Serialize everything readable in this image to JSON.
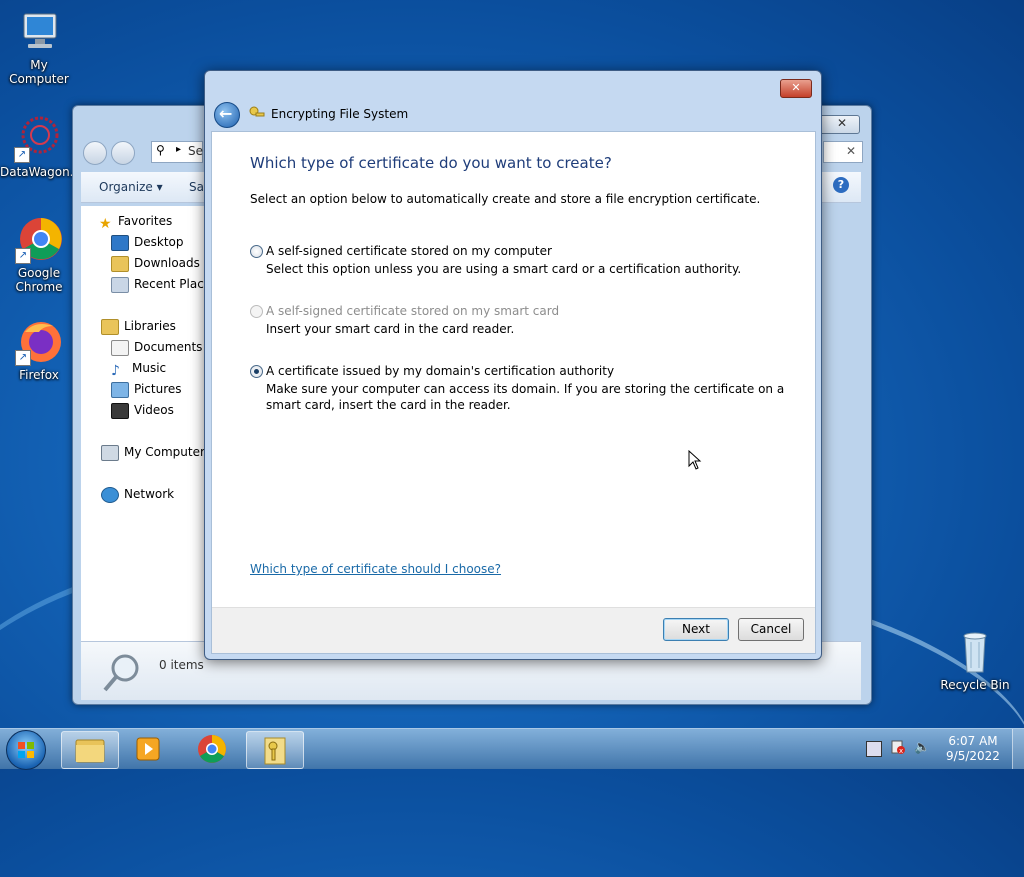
{
  "desktop": {
    "icons": [
      {
        "label": "My Computer"
      },
      {
        "label": "DataWagon..."
      },
      {
        "label": "Google Chrome"
      },
      {
        "label": "Firefox"
      },
      {
        "label": "Recycle Bin"
      }
    ]
  },
  "explorer": {
    "search_fragment": "Se",
    "organize_label": "Organize ▾",
    "save_fragment": "Sav",
    "nav": {
      "favorites": "Favorites",
      "desktop": "Desktop",
      "downloads": "Downloads",
      "recent_places": "Recent Places",
      "libraries": "Libraries",
      "documents": "Documents",
      "music": "Music",
      "pictures": "Pictures",
      "videos": "Videos",
      "my_computer": "My Computer",
      "network": "Network"
    },
    "item_count": "0 items"
  },
  "dialog": {
    "title": "Encrypting File System",
    "heading": "Which type of certificate do you want to create?",
    "intro": "Select an option below to automatically create and store a file encryption certificate.",
    "options": [
      {
        "label": "A self-signed certificate stored on my computer",
        "description": "Select this option unless you are using a smart card or a certification authority.",
        "selected": false,
        "enabled": true
      },
      {
        "label": "A self-signed certificate stored on my smart card",
        "description": "Insert your smart card in the card reader.",
        "selected": false,
        "enabled": false
      },
      {
        "label": "A certificate issued by my domain's certification authority",
        "description_line1": "Make sure your computer can access its domain. If you are storing the certificate on a",
        "description_line2": "smart card, insert the card in the reader.",
        "selected": true,
        "enabled": true
      }
    ],
    "help_link": "Which type of certificate should I choose?",
    "next_label": "Next",
    "cancel_label": "Cancel"
  },
  "taskbar": {
    "time": "6:07 AM",
    "date": "9/5/2022"
  },
  "colors": {
    "heading": "#1f3d7a",
    "link": "#1a6aa8",
    "disabled_text": "#8d8d8d"
  }
}
